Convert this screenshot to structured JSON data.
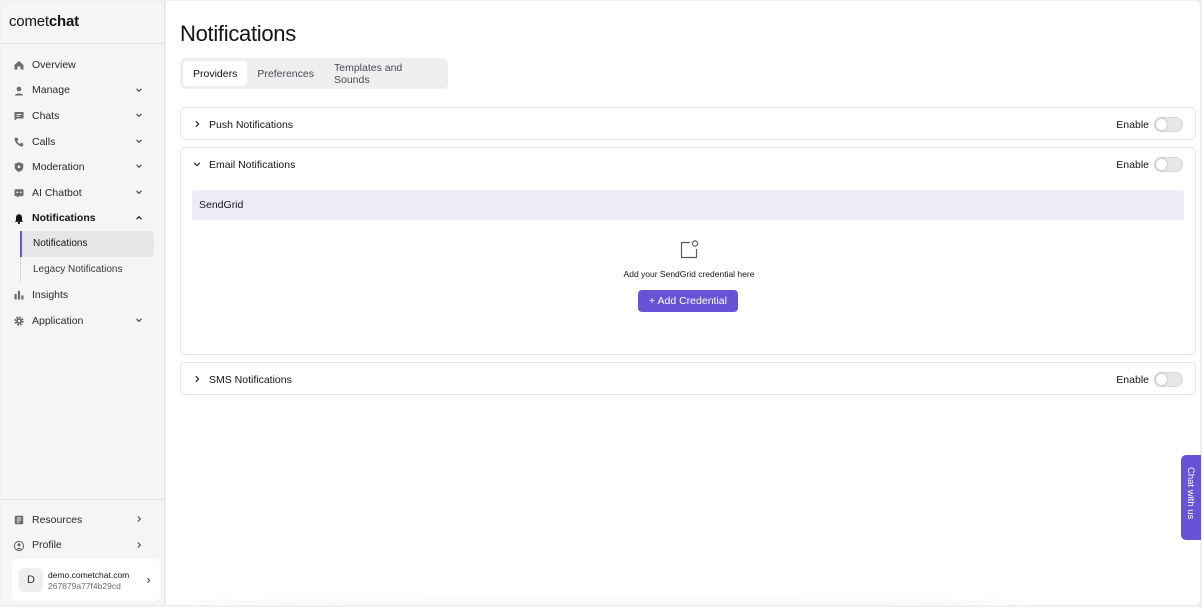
{
  "brand": {
    "light": "comet",
    "bold": "chat"
  },
  "sidebar": {
    "items": [
      {
        "label": "Overview",
        "icon": "home-icon",
        "chevron": "none"
      },
      {
        "label": "Manage",
        "icon": "user-icon",
        "chevron": "down"
      },
      {
        "label": "Chats",
        "icon": "chat-icon",
        "chevron": "down"
      },
      {
        "label": "Calls",
        "icon": "phone-icon",
        "chevron": "down"
      },
      {
        "label": "Moderation",
        "icon": "shield-icon",
        "chevron": "down"
      },
      {
        "label": "AI Chatbot",
        "icon": "bot-icon",
        "chevron": "down"
      },
      {
        "label": "Notifications",
        "icon": "bell-icon",
        "chevron": "up"
      }
    ],
    "sub_items": [
      {
        "label": "Notifications",
        "active": true
      },
      {
        "label": "Legacy Notifications",
        "active": false
      }
    ],
    "items_after": [
      {
        "label": "Insights",
        "icon": "chart-icon",
        "chevron": "none"
      },
      {
        "label": "Application",
        "icon": "gear-icon",
        "chevron": "down"
      }
    ],
    "bottom": [
      {
        "label": "Resources",
        "icon": "book-icon"
      },
      {
        "label": "Profile",
        "icon": "profile-icon"
      }
    ],
    "user": {
      "initial": "D",
      "name": "demo.cometchat.com",
      "id": "267879a77f4b29cd"
    }
  },
  "main": {
    "title": "Notifications",
    "tabs": [
      "Providers",
      "Preferences",
      "Templates and Sounds"
    ],
    "active_tab": "Providers",
    "panels": {
      "push": {
        "title": "Push Notifications",
        "enable_label": "Enable",
        "enabled": false,
        "expanded": false
      },
      "email": {
        "title": "Email Notifications",
        "enable_label": "Enable",
        "enabled": false,
        "expanded": true
      },
      "sms": {
        "title": "SMS Notifications",
        "enable_label": "Enable",
        "enabled": false,
        "expanded": false
      }
    },
    "email_provider": {
      "name": "SendGrid",
      "empty_text": "Add your SendGrid credential here",
      "button_label": "+ Add Credential"
    }
  },
  "chat_widget": {
    "label": "Chat with us"
  },
  "colors": {
    "accent": "#6852d6",
    "provider_bg": "#eeecf8",
    "sidebar_bg": "#f5f5f6"
  }
}
